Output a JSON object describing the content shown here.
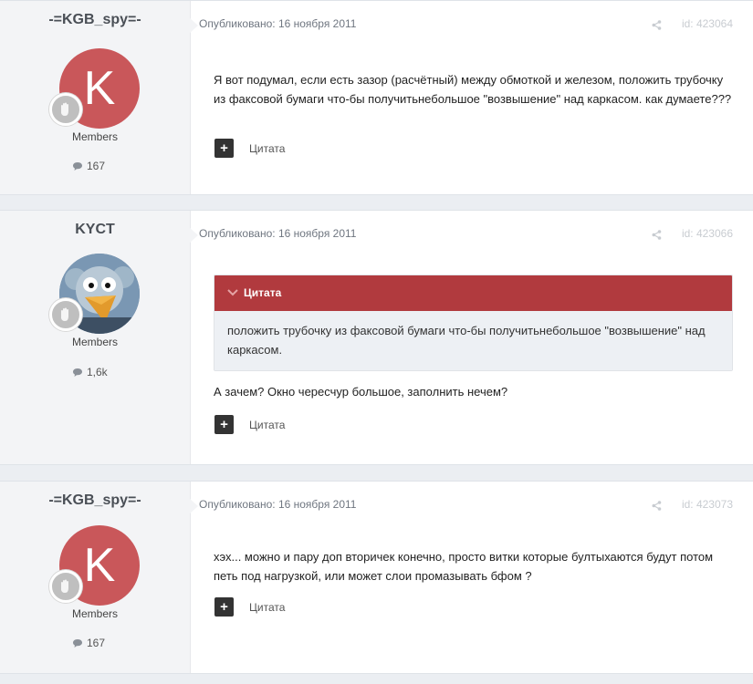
{
  "posts": [
    {
      "author": "-=KGB_spy=-",
      "avatar_letter": "K",
      "role": "Members",
      "post_count": "167",
      "published": "Опубликовано: 16 ноября 2011",
      "post_id": "id: 423064",
      "text": "Я вот подумал, если есть зазор (расчётный) между обмоткой и железом, положить трубочку из факсовой бумаги что-бы получитьнебольшое \"возвышение\" над каркасом. как думаете???",
      "quote_label": "Цитата"
    },
    {
      "author": "KYCT",
      "role": "Members",
      "post_count": "1,6k",
      "published": "Опубликовано: 16 ноября 2011",
      "post_id": "id: 423066",
      "quote_title": "Цитата",
      "quote_text": "положить трубочку из факсовой бумаги что-бы получитьнебольшое \"возвышение\" над каркасом.",
      "text": "А зачем? Окно чересчур большое, заполнить нечем?",
      "quote_label": "Цитата"
    },
    {
      "author": "-=KGB_spy=-",
      "avatar_letter": "K",
      "role": "Members",
      "post_count": "167",
      "published": "Опубликовано: 16 ноября 2011",
      "post_id": "id: 423073",
      "text": "хэх... можно и пару доп вторичек конечно, просто витки которые бултыхаются будут потом петь под нагрузкой, или может слои промазывать бфом ?",
      "quote_label": "Цитата"
    }
  ],
  "colors": {
    "avatar_red": "#c9575a",
    "quote_header": "#b13a3e",
    "page_bg": "#ebeef2"
  }
}
